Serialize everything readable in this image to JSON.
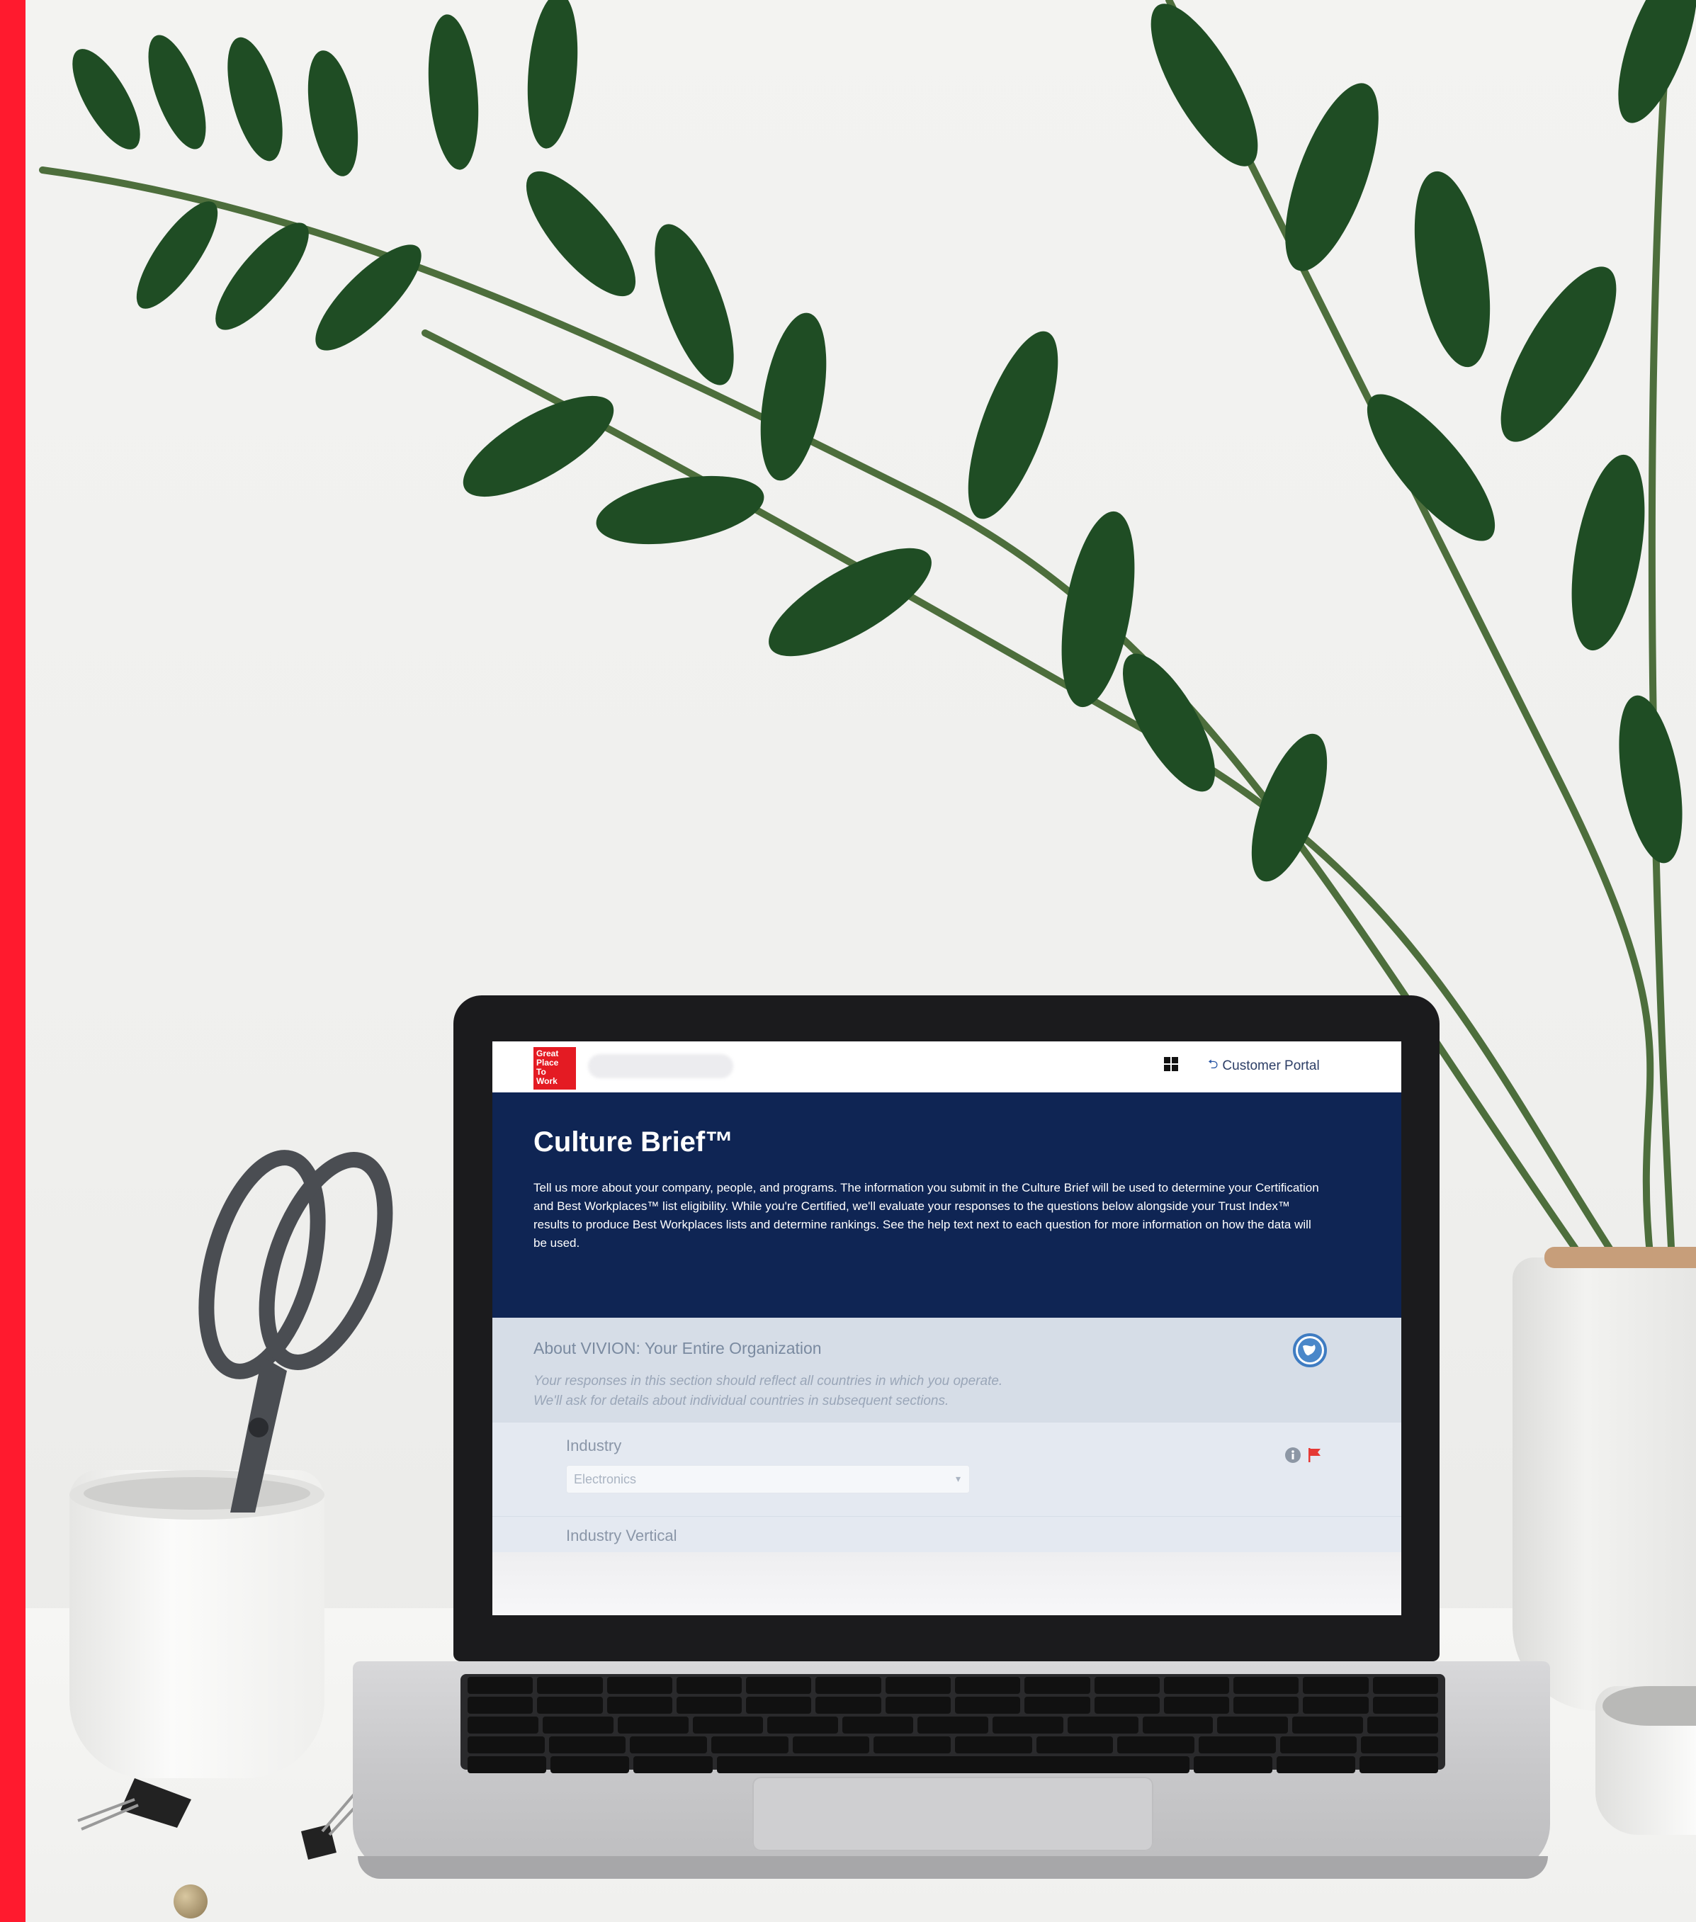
{
  "topnav": {
    "logo_lines": [
      "Great",
      "Place",
      "To",
      "Work"
    ],
    "portal_link": "Customer Portal"
  },
  "hero": {
    "title": "Culture Brief™",
    "description": "Tell us more about your company, people, and programs. The information you submit in the Culture Brief will be used to determine your Certification and Best Workplaces™ list eligibility. While you're Certified, we'll evaluate your responses to the questions below alongside your Trust Index™ results to produce Best Workplaces lists and determine rankings. See the help text next to each question for more information on how the data will be used."
  },
  "section": {
    "title": "About VIVION: Your Entire Organization",
    "note_line1": "Your responses in this section should reflect all countries in which you operate.",
    "note_line2": "We'll ask for details about individual countries in subsequent sections."
  },
  "industry": {
    "label": "Industry",
    "value": "Electronics"
  },
  "industry_vertical": {
    "label": "Industry Vertical"
  },
  "colors": {
    "accent_red": "#ff1a2e",
    "hero_navy": "#0f2554",
    "logo_red": "#e41b23"
  },
  "icons": [
    "grid-icon",
    "return-arrow-icon",
    "globe-icon",
    "info-icon",
    "flag-icon",
    "chevron-down-icon"
  ]
}
